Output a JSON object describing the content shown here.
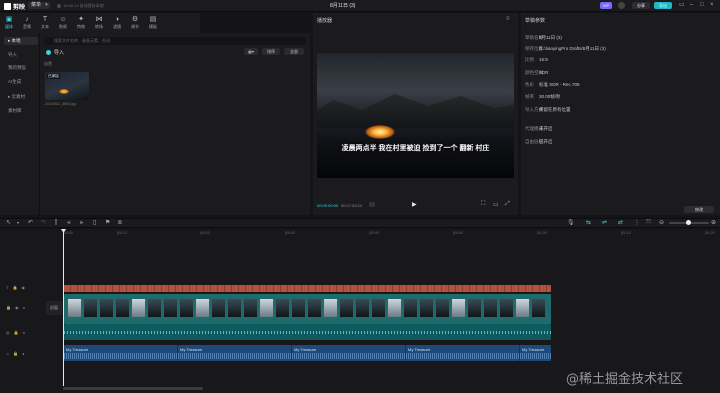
{
  "app": {
    "name": "剪映",
    "menu_label": "菜单",
    "autosave": "12:50:13 自动保存本地",
    "title": "8月11日 (3)"
  },
  "topbar": {
    "vip_label": "VIP",
    "share_label": "分享",
    "export_label": "导出"
  },
  "tools": [
    {
      "label": "媒体",
      "icon": "▣"
    },
    {
      "label": "音频",
      "icon": "♪"
    },
    {
      "label": "文本",
      "icon": "T"
    },
    {
      "label": "贴纸",
      "icon": "☺"
    },
    {
      "label": "特效",
      "icon": "✦"
    },
    {
      "label": "转场",
      "icon": "⋈"
    },
    {
      "label": "滤镜",
      "icon": "◑"
    },
    {
      "label": "调节",
      "icon": "⚙"
    },
    {
      "label": "模板",
      "icon": "▤"
    }
  ],
  "sidenav": [
    {
      "label": "▸ 本地"
    },
    {
      "label": "导入"
    },
    {
      "label": "我的预设"
    },
    {
      "label": "AI生成"
    },
    {
      "label": "▸ 云素材"
    },
    {
      "label": "素材库"
    }
  ],
  "media": {
    "search_placeholder": "搜索文件名称、画面元素、台词",
    "import_label": "导入",
    "sort_label": "排序",
    "all_label": "全部",
    "group_label": "自然",
    "thumb_badge": "已添加",
    "thumb_name": "20240811_4653.jpg"
  },
  "player": {
    "title": "播放器",
    "subtitle": "凌晨两点半 我在村里被迫 捡到了一个 翻新 村庄",
    "time_current": "00:00:00:00",
    "time_total": "00:07:53:24"
  },
  "props": {
    "title": "草稿参数",
    "rows": [
      {
        "k": "草稿名称",
        "v": "8月11日 (3)"
      },
      {
        "k": "保存位置",
        "v": "D:/JianyingPro Drafts/8月11日 (3)"
      },
      {
        "k": "比例",
        "v": "16:9"
      },
      {
        "k": "颜色空间",
        "v": "SDR"
      },
      {
        "k": "色彩",
        "v": "标准 SDR - Rec.709"
      },
      {
        "k": "帧率",
        "v": "30.00帧/秒"
      },
      {
        "k": "导入方式",
        "v": "保留在原有位置"
      },
      {
        "k": "代理模式",
        "v": "未开启"
      },
      {
        "k": "自由层级",
        "v": "已开启"
      }
    ],
    "modify_label": "修改"
  },
  "timeline": {
    "ruler": [
      "00:00",
      "|00:10",
      "|00:20",
      "|00:30",
      "|00:40",
      "|00:50",
      "|01:00",
      "|01:10",
      "|01:20"
    ],
    "cover_label": "封面",
    "music_label": "My Treasure"
  },
  "watermark": "@稀土掘金技术社区"
}
